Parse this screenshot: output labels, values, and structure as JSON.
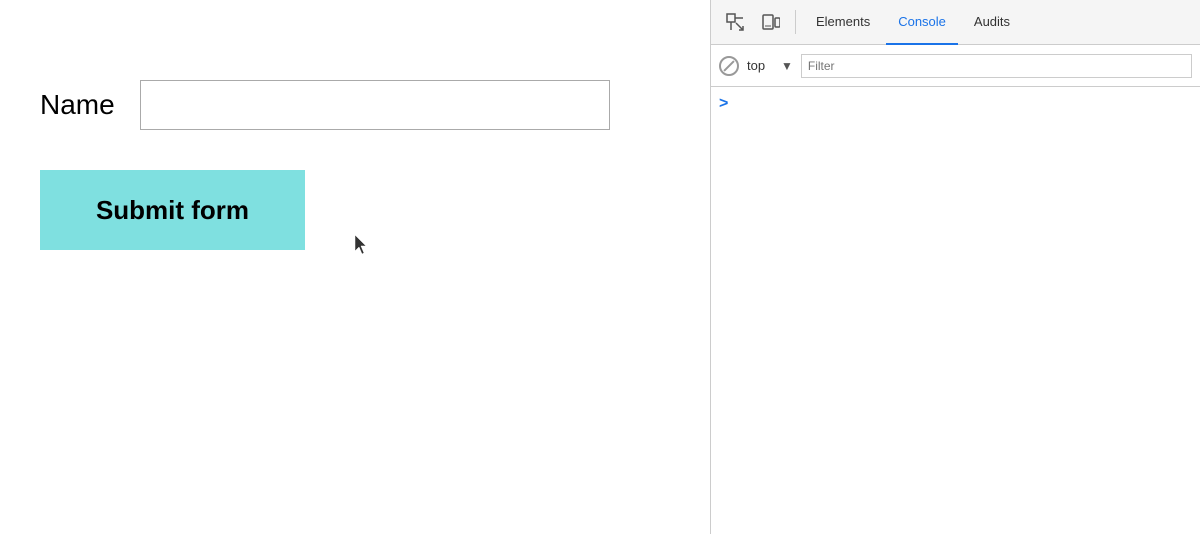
{
  "webpage": {
    "form": {
      "label": "Name",
      "input_placeholder": "",
      "submit_label": "Submit form"
    }
  },
  "devtools": {
    "toolbar": {
      "tabs": [
        {
          "id": "elements",
          "label": "Elements",
          "active": false
        },
        {
          "id": "console",
          "label": "Console",
          "active": true
        },
        {
          "id": "audits",
          "label": "Audits",
          "active": false
        }
      ]
    },
    "console_bar": {
      "context_value": "top",
      "filter_placeholder": "Filter"
    },
    "console_content": {
      "prompt_symbol": ">"
    }
  }
}
